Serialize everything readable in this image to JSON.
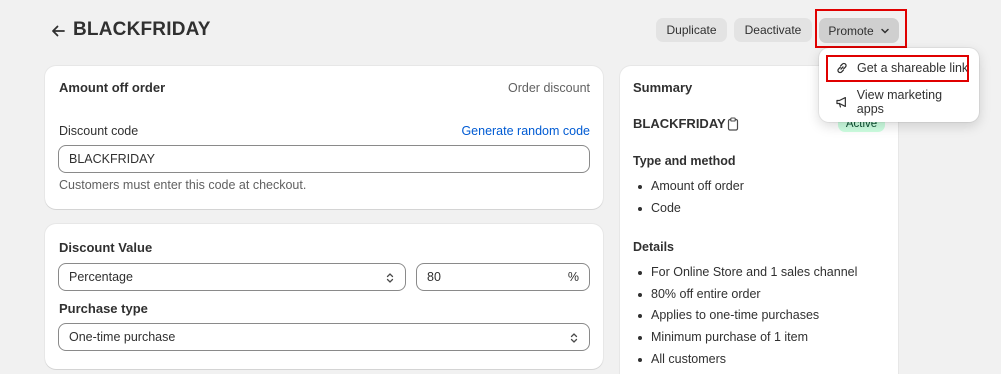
{
  "header": {
    "title": "BLACKFRIDAY",
    "back_icon": "arrow-left-icon",
    "actions": {
      "duplicate": "Duplicate",
      "deactivate": "Deactivate",
      "promote": "Promote"
    }
  },
  "promote_menu": {
    "items": [
      {
        "label": "Get a shareable link",
        "icon": "link-icon"
      },
      {
        "label": "View marketing apps",
        "icon": "megaphone-icon"
      }
    ]
  },
  "amount_card": {
    "title": "Amount off order",
    "type_label": "Order discount",
    "code_label": "Discount code",
    "generate_link": "Generate random code",
    "code_value": "BLACKFRIDAY",
    "help_text": "Customers must enter this code at checkout."
  },
  "value_card": {
    "title": "Discount Value",
    "value_type": "Percentage",
    "value": "80",
    "suffix": "%",
    "purchase_type_label": "Purchase type",
    "purchase_type": "One-time purchase"
  },
  "summary": {
    "title": "Summary",
    "code": "BLACKFRIDAY",
    "status": "Active",
    "type_heading": "Type and method",
    "type_items": [
      "Amount off order",
      "Code"
    ],
    "details_heading": "Details",
    "details_items": [
      "For Online Store and 1 sales channel",
      "80% off entire order",
      "Applies to one-time purchases",
      "Minimum purchase of 1 item",
      "All customers"
    ]
  },
  "colors": {
    "accent_link": "#005bd3",
    "highlight": "#e00000",
    "active_badge": "#cdfee1"
  }
}
